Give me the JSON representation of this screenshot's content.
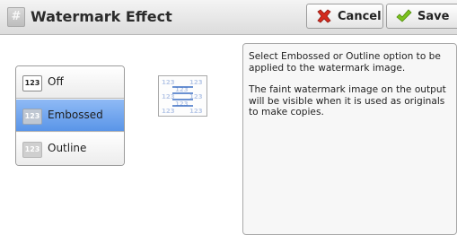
{
  "header": {
    "title": "Watermark Effect",
    "title_icon": "page-symbol-icon",
    "cancel_label": "Cancel",
    "cancel_icon": "x-icon",
    "save_label": "Save",
    "save_icon": "checkmark-icon"
  },
  "options": [
    {
      "icon_text": "123",
      "label": "Off",
      "selected": false
    },
    {
      "icon_text": "123",
      "label": "Embossed",
      "selected": true
    },
    {
      "icon_text": "123",
      "label": "Outline",
      "selected": false
    }
  ],
  "preview": {
    "icon": "watermark-preview-icon"
  },
  "info": {
    "paragraph1": "Select Embossed or Outline option to be applied to the watermark image.",
    "paragraph2": "The faint watermark image on the output will be visible when it is used as originals to make copies."
  },
  "colors": {
    "selected_accent": "#5a95e8",
    "cancel_icon": "#d42b1e",
    "save_icon": "#7cc21d"
  }
}
